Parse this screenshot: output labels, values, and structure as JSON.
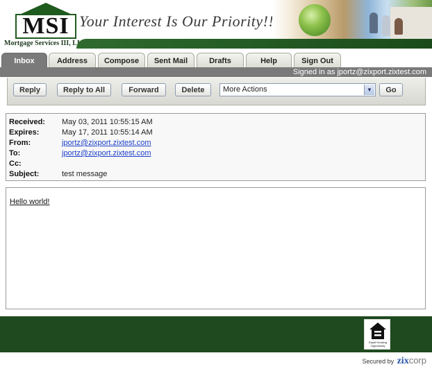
{
  "header": {
    "logo_text": "MSI",
    "company_name": "Mortgage Services III, LLC",
    "tagline": "Your Interest Is Our Priority!!"
  },
  "tabs": [
    {
      "label": "Inbox",
      "active": true
    },
    {
      "label": "Address",
      "active": false
    },
    {
      "label": "Compose",
      "active": false
    },
    {
      "label": "Sent Mail",
      "active": false
    },
    {
      "label": "Drafts",
      "active": false
    },
    {
      "label": "Help",
      "active": false
    },
    {
      "label": "Sign Out",
      "active": false
    }
  ],
  "signed_in": "Signed in as jportz@zixport.zixtest.com",
  "toolbar": {
    "reply_label": "Reply",
    "reply_all_label": "Reply to All",
    "forward_label": "Forward",
    "delete_label": "Delete",
    "more_actions": "More Actions",
    "go_label": "Go"
  },
  "message": {
    "received_label": "Received:",
    "received": "May 03, 2011 10:55:15 AM",
    "expires_label": "Expires:",
    "expires": "May 17, 2011 10:55:14 AM",
    "from_label": "From:",
    "from": "jportz@zixport.zixtest.com",
    "to_label": "To:",
    "to": "jportz@zixport.zixtest.com",
    "cc_label": "Cc:",
    "cc": "",
    "subject_label": "Subject:",
    "subject": "test message",
    "body": "Hello world!"
  },
  "footer": {
    "eho_text": "Equal Housing Opportunity",
    "secured_by": "Secured by",
    "zix": "zix",
    "corp": "corp"
  },
  "colors": {
    "brand_green": "#1f4a1f",
    "tab_active": "#7a7a7a",
    "link": "#1a3ec8"
  }
}
